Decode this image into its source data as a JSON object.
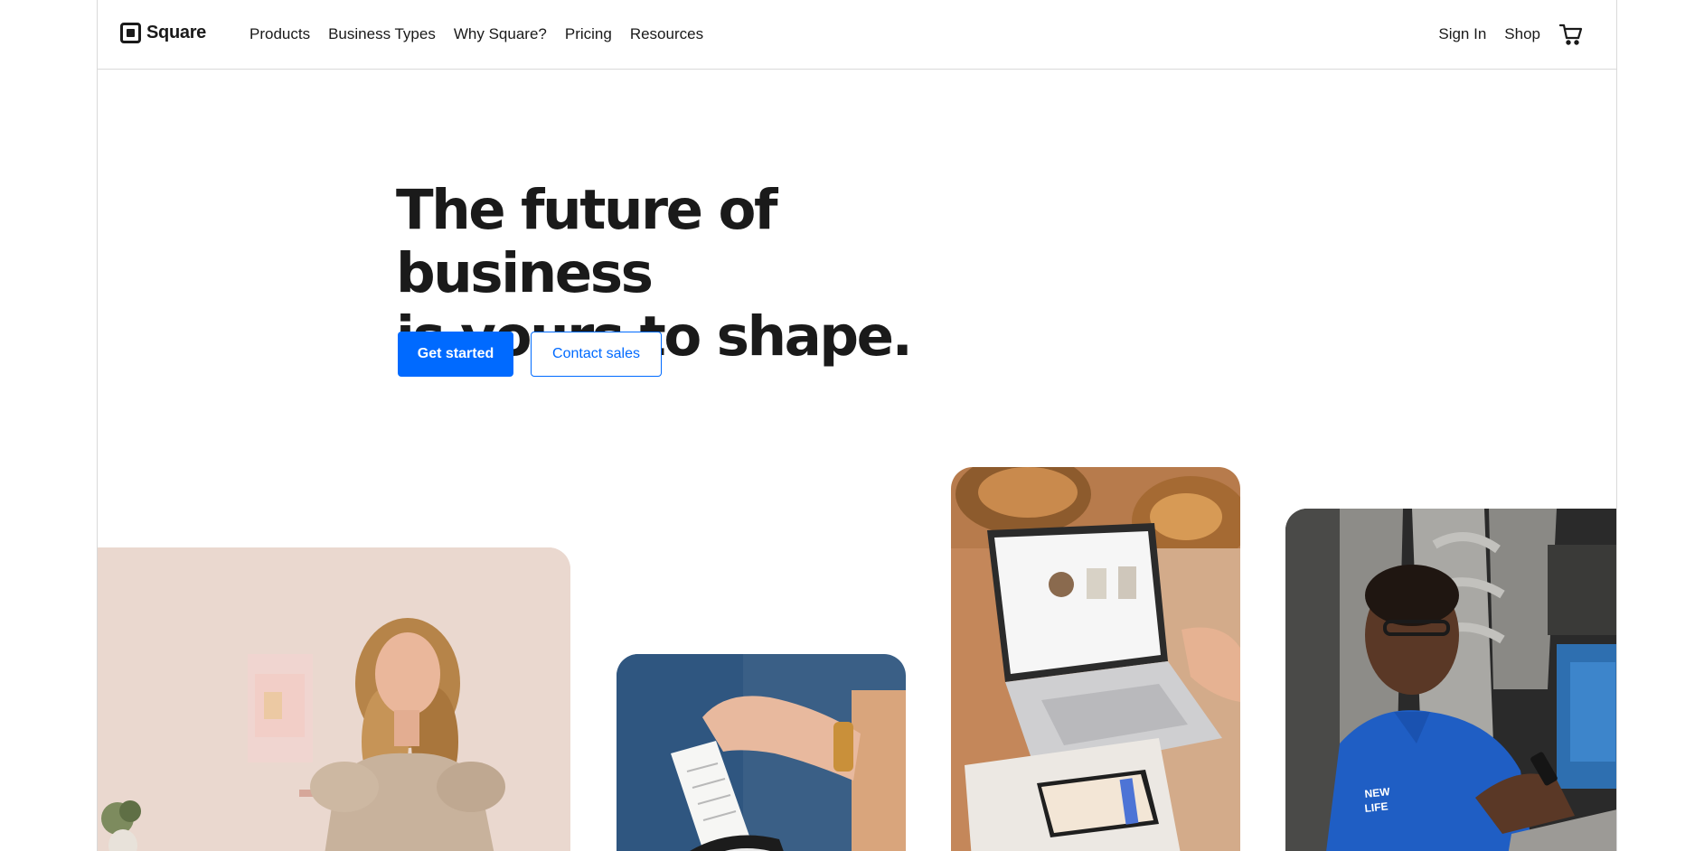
{
  "brand": {
    "name": "Square",
    "accent": "#006aff"
  },
  "nav": {
    "items": [
      {
        "label": "Products"
      },
      {
        "label": "Business Types"
      },
      {
        "label": "Why Square?"
      },
      {
        "label": "Pricing"
      },
      {
        "label": "Resources"
      }
    ],
    "sign_in": "Sign In",
    "shop": "Shop",
    "cart_icon": "cart-icon"
  },
  "hero": {
    "title_line1": "The future of business",
    "title_line2": "is yours to shape.",
    "primary_cta": "Get started",
    "secondary_cta": "Contact sales"
  },
  "images": [
    {
      "name": "woman-seated-photo"
    },
    {
      "name": "receipt-printer-photo"
    },
    {
      "name": "laptop-bakery-photo"
    },
    {
      "name": "man-with-phone-photo"
    }
  ]
}
